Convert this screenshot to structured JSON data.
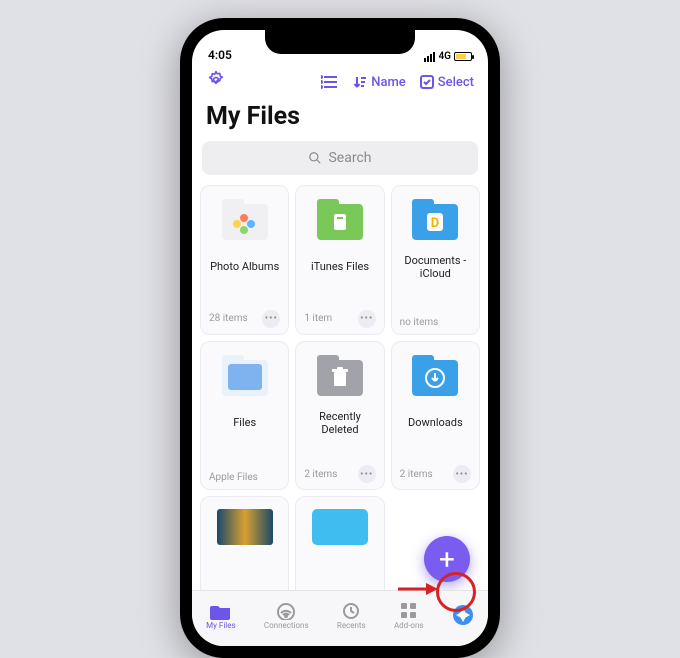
{
  "status": {
    "time": "4:05",
    "network": "4G"
  },
  "toolbar": {
    "sort_label": "Name",
    "select_label": "Select"
  },
  "page_title": "My Files",
  "search_placeholder": "Search",
  "folders": [
    {
      "label": "Photo Albums",
      "meta": "28 items",
      "show_more": true,
      "color": "#f0f0f2",
      "glyph": "photos"
    },
    {
      "label": "iTunes Files",
      "meta": "1 item",
      "show_more": true,
      "color": "#79c858",
      "glyph": "itunes"
    },
    {
      "label": "Documents - iCloud",
      "meta": "no items",
      "show_more": false,
      "color": "#3aa1e8",
      "glyph": "doc"
    },
    {
      "label": "Files",
      "meta": "Apple Files",
      "show_more": false,
      "color": "#7fb3ef",
      "glyph": "files"
    },
    {
      "label": "Recently Deleted",
      "meta": "2 items",
      "show_more": true,
      "color": "#a1a3a8",
      "glyph": "trash"
    },
    {
      "label": "Downloads",
      "meta": "2 items",
      "show_more": true,
      "color": "#3aa1e8",
      "glyph": "download"
    }
  ],
  "tabs": [
    {
      "label": "My Files",
      "icon": "folder",
      "active": true
    },
    {
      "label": "Connections",
      "icon": "wifi",
      "active": false
    },
    {
      "label": "Recents",
      "icon": "clock",
      "active": false
    },
    {
      "label": "Add-ons",
      "icon": "grid",
      "active": false
    },
    {
      "label": "",
      "icon": "compass",
      "active": false
    }
  ]
}
